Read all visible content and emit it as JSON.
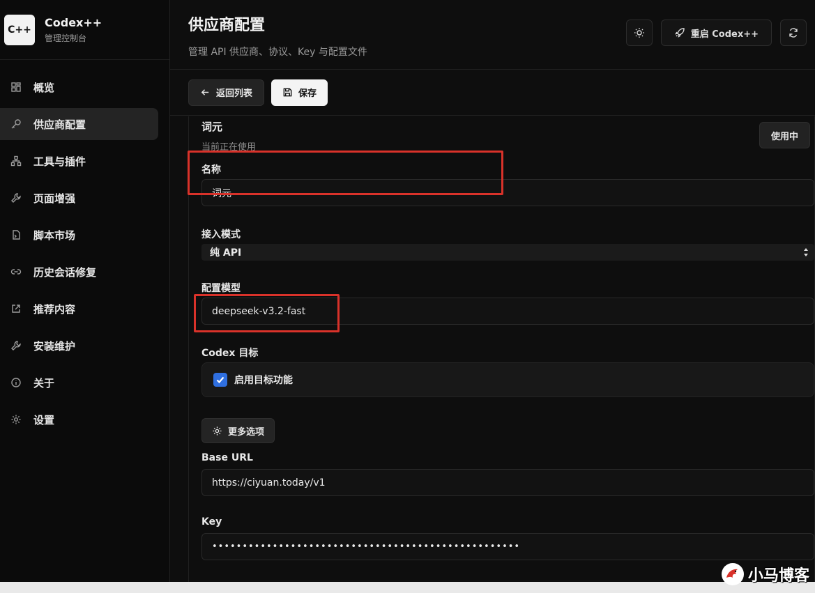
{
  "brand": {
    "logo_text": "C++",
    "title": "Codex++",
    "subtitle": "管理控制台"
  },
  "sidebar": {
    "items": [
      {
        "label": "概览",
        "icon": "grid-icon"
      },
      {
        "label": "供应商配置",
        "icon": "key-icon",
        "active": true
      },
      {
        "label": "工具与插件",
        "icon": "network-icon"
      },
      {
        "label": "页面增强",
        "icon": "wrench-icon"
      },
      {
        "label": "脚本市场",
        "icon": "script-icon"
      },
      {
        "label": "历史会话修复",
        "icon": "link-icon"
      },
      {
        "label": "推荐内容",
        "icon": "external-link-icon"
      },
      {
        "label": "安装维护",
        "icon": "wrench-icon"
      },
      {
        "label": "关于",
        "icon": "info-icon"
      },
      {
        "label": "设置",
        "icon": "gear-icon"
      }
    ]
  },
  "header": {
    "title": "供应商配置",
    "subtitle": "管理 API 供应商、协议、Key 与配置文件",
    "restart_label": "重启 Codex++"
  },
  "toolbar": {
    "back_label": "返回列表",
    "save_label": "保存"
  },
  "provider": {
    "name": "词元",
    "status": "当前正在使用",
    "in_use_label": "使用中",
    "name_label": "名称",
    "name_value": "词元",
    "mode_label": "接入模式",
    "mode_value": "纯 API",
    "model_label": "配置模型",
    "model_value": "deepseek-v3.2-fast",
    "target_label": "Codex 目标",
    "target_checkbox_label": "启用目标功能",
    "target_enabled": true,
    "more_options_label": "更多选项",
    "base_url_label": "Base URL",
    "base_url_value": "https://ciyuan.today/v1",
    "key_label": "Key",
    "key_value": "•••••••••••••••••••••••••••••••••••••••••••••••••••"
  },
  "watermark": {
    "text": "小马博客"
  },
  "colors": {
    "accent": "#2f6fe0",
    "highlight": "#d9322a",
    "background": "#0e0e0e"
  }
}
